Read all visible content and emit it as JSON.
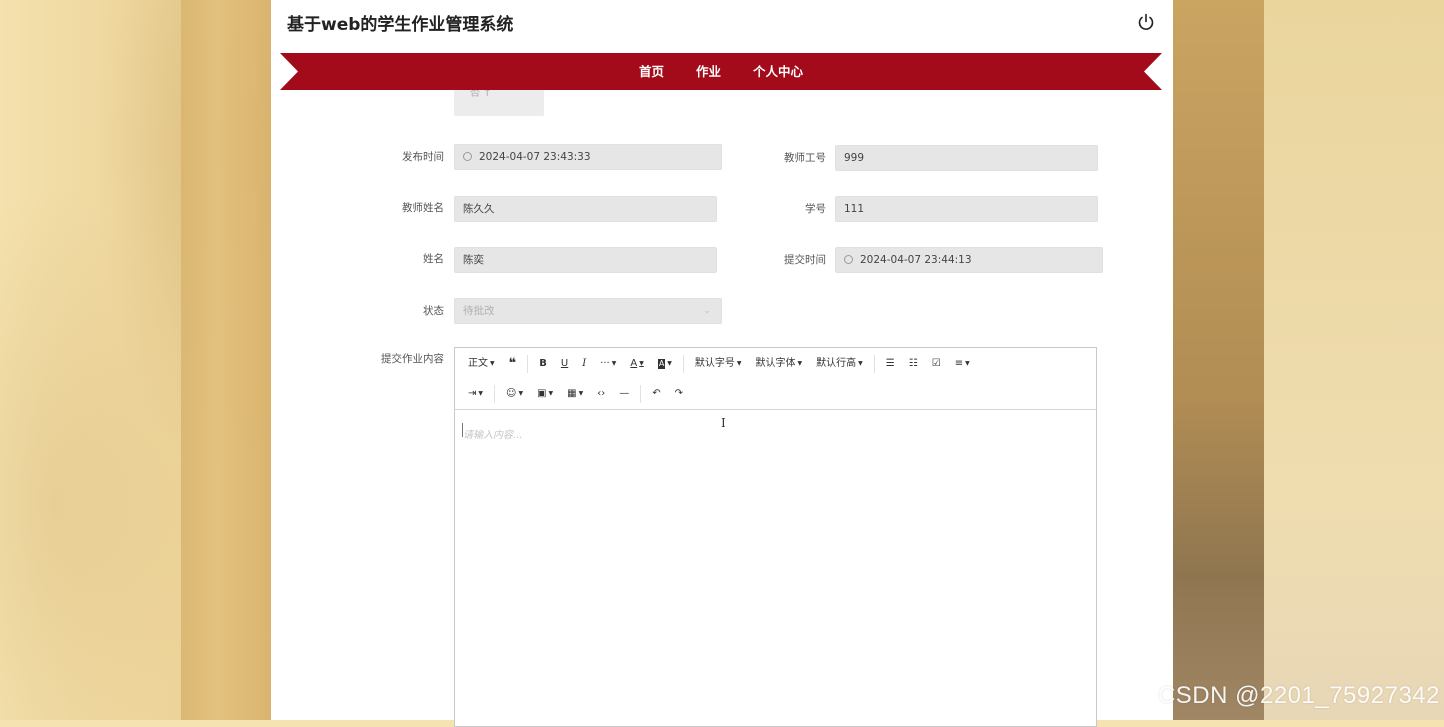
{
  "app": {
    "title": "基于web的学生作业管理系统"
  },
  "nav": {
    "items": [
      {
        "label": "首页",
        "active": false
      },
      {
        "label": "作业",
        "active": true
      },
      {
        "label": "个人中心",
        "active": false
      }
    ],
    "banner_color": "#a30a1a"
  },
  "partial_field": {
    "text": "否 ↑"
  },
  "form": {
    "publish_time": {
      "label": "发布时间",
      "value": "2024-04-07 23:43:33"
    },
    "teacher_id": {
      "label": "教师工号",
      "value": "999"
    },
    "teacher_name": {
      "label": "教师姓名",
      "value": "陈久久"
    },
    "student_id": {
      "label": "学号",
      "value": "111"
    },
    "name": {
      "label": "姓名",
      "value": "陈奕"
    },
    "submit_time": {
      "label": "提交时间",
      "value": "2024-04-07 23:44:13"
    },
    "status": {
      "label": "状态",
      "value": "待批改"
    },
    "content": {
      "label": "提交作业内容",
      "placeholder": "请输入内容..."
    }
  },
  "toolbar": {
    "paragraph": "正文",
    "quote": "❝",
    "bold": "B",
    "underline": "U",
    "italic": "I",
    "more": "···",
    "font_color": "A",
    "bg_color": "A",
    "font_size": "默认字号",
    "font_family": "默认字体",
    "line_height": "默认行高",
    "bullet_list": "☰",
    "numbered_list": "☷",
    "todo": "☑",
    "align": "≡",
    "indent": "⇥",
    "emoji": "☺",
    "image": "▣",
    "table": "▦",
    "code": "‹›",
    "divider": "—",
    "undo": "↶",
    "redo": "↷"
  },
  "watermark": "CSDN @2201_75927342"
}
